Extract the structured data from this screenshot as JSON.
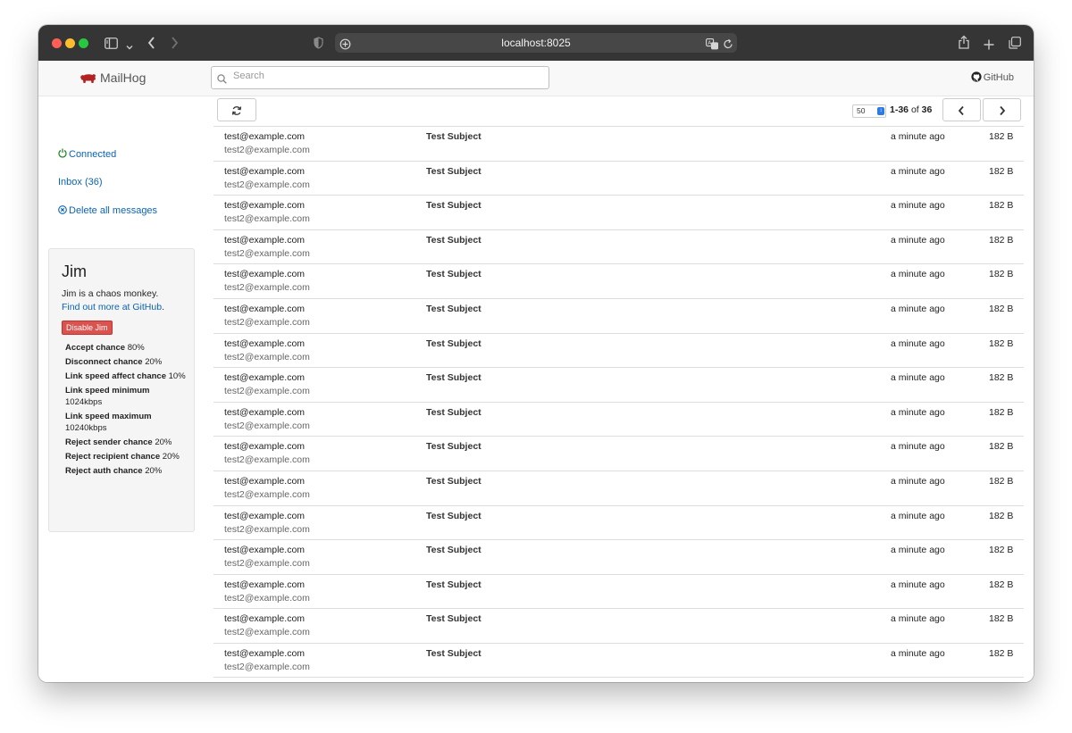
{
  "browser": {
    "url": "localhost:8025",
    "traffic_light_colors": [
      "#ff5f57",
      "#febc2e",
      "#28c840"
    ],
    "icons": [
      "sidebar-icon",
      "chevron-down-icon",
      "back-icon",
      "forward-icon",
      "shield-icon",
      "site-settings-icon",
      "translate-icon",
      "reload-icon",
      "share-icon",
      "new-tab-icon",
      "tabs-overview-icon"
    ]
  },
  "nav": {
    "brand": "MailHog",
    "brand_color": "#b22222",
    "search_placeholder": "Search",
    "github_label": "GitHub"
  },
  "sidebar": {
    "connected_label": "Connected",
    "connected_color": "#2e8b2e",
    "inbox_label": "Inbox (36)",
    "delete_label": "Delete all messages",
    "link_color": "#0a63b4"
  },
  "jim": {
    "title": "Jim",
    "description": "Jim is a chaos monkey.",
    "link_text": "Find out more at GitHub",
    "link_suffix": ".",
    "disable_label": "Disable Jim",
    "settings": [
      {
        "label": "Accept chance",
        "value": "80%"
      },
      {
        "label": "Disconnect chance",
        "value": "20%"
      },
      {
        "label": "Link speed affect chance",
        "value": "10%"
      },
      {
        "label": "Link speed minimum",
        "value": "1024kbps"
      },
      {
        "label": "Link speed maximum",
        "value": "10240kbps"
      },
      {
        "label": "Reject sender chance",
        "value": "20%"
      },
      {
        "label": "Reject recipient chance",
        "value": "20%"
      },
      {
        "label": "Reject auth chance",
        "value": "20%"
      }
    ]
  },
  "toolbar": {
    "per_page": "50",
    "range": "1-36",
    "of_label": "of",
    "total": "36"
  },
  "messages": [
    {
      "from": "test@example.com",
      "to": "test2@example.com",
      "subject": "Test Subject",
      "time": "a minute ago",
      "size": "182 B"
    },
    {
      "from": "test@example.com",
      "to": "test2@example.com",
      "subject": "Test Subject",
      "time": "a minute ago",
      "size": "182 B"
    },
    {
      "from": "test@example.com",
      "to": "test2@example.com",
      "subject": "Test Subject",
      "time": "a minute ago",
      "size": "182 B"
    },
    {
      "from": "test@example.com",
      "to": "test2@example.com",
      "subject": "Test Subject",
      "time": "a minute ago",
      "size": "182 B"
    },
    {
      "from": "test@example.com",
      "to": "test2@example.com",
      "subject": "Test Subject",
      "time": "a minute ago",
      "size": "182 B"
    },
    {
      "from": "test@example.com",
      "to": "test2@example.com",
      "subject": "Test Subject",
      "time": "a minute ago",
      "size": "182 B"
    },
    {
      "from": "test@example.com",
      "to": "test2@example.com",
      "subject": "Test Subject",
      "time": "a minute ago",
      "size": "182 B"
    },
    {
      "from": "test@example.com",
      "to": "test2@example.com",
      "subject": "Test Subject",
      "time": "a minute ago",
      "size": "182 B"
    },
    {
      "from": "test@example.com",
      "to": "test2@example.com",
      "subject": "Test Subject",
      "time": "a minute ago",
      "size": "182 B"
    },
    {
      "from": "test@example.com",
      "to": "test2@example.com",
      "subject": "Test Subject",
      "time": "a minute ago",
      "size": "182 B"
    },
    {
      "from": "test@example.com",
      "to": "test2@example.com",
      "subject": "Test Subject",
      "time": "a minute ago",
      "size": "182 B"
    },
    {
      "from": "test@example.com",
      "to": "test2@example.com",
      "subject": "Test Subject",
      "time": "a minute ago",
      "size": "182 B"
    },
    {
      "from": "test@example.com",
      "to": "test2@example.com",
      "subject": "Test Subject",
      "time": "a minute ago",
      "size": "182 B"
    },
    {
      "from": "test@example.com",
      "to": "test2@example.com",
      "subject": "Test Subject",
      "time": "a minute ago",
      "size": "182 B"
    },
    {
      "from": "test@example.com",
      "to": "test2@example.com",
      "subject": "Test Subject",
      "time": "a minute ago",
      "size": "182 B"
    },
    {
      "from": "test@example.com",
      "to": "test2@example.com",
      "subject": "Test Subject",
      "time": "a minute ago",
      "size": "182 B"
    }
  ]
}
